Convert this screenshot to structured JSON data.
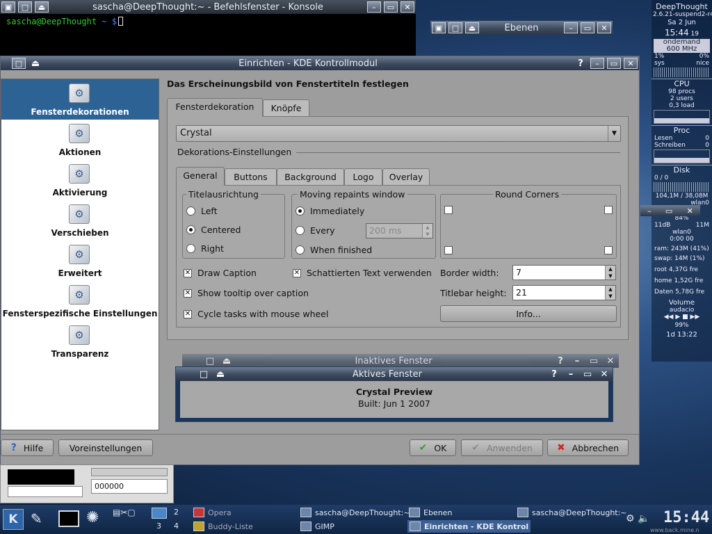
{
  "konsole": {
    "title": "sascha@DeepThought:~ - Befehlsfenster - Konsole",
    "prompt_host": "sascha@DeepThought",
    "prompt_path": "~ $"
  },
  "ebenen": {
    "title": "Ebenen"
  },
  "sysmon": {
    "hostname": "DeepThought",
    "kernel": "2.6.21-suspend2-r4",
    "date": "Sa 2 Jun",
    "time": "15:44",
    "seconds": "19",
    "cpu_governor": "ondemand",
    "cpu_freq": "600 MHz",
    "cpu_pct": "1%",
    "cpu_pct2": "0%",
    "sys": "sys",
    "nice": "nice",
    "cpu_label": "CPU",
    "procs": "98 procs",
    "users": "2 users",
    "load": "0,3 load",
    "proc_label": "Proc",
    "lesen": "Lesen",
    "lesen_v": "0",
    "schreiben": "Schreiben",
    "schreiben_v": "0",
    "disk_label": "Disk",
    "disk_ratio": "0 / 0",
    "disk_mem": "104,1M / 38,08M",
    "wlan_label": "wlan0",
    "wlan_pct": "84%",
    "wlan_db": "11dB",
    "wlan_rate": "11M",
    "wlan2": "wlan0",
    "wlan_time": "0:00  00",
    "ram": "ram: 243M (41%)",
    "swap": "swap: 14M (1%)",
    "root": "root 4,37G fre",
    "home": "home 1,52G fre",
    "daten": "Daten 5,78G fre",
    "volume_label": "Volume",
    "audacio": "audacio",
    "battery": "99%",
    "uptime": "1d 13:22"
  },
  "dialog": {
    "title": "Einrichten - KDE Kontrollmodul",
    "heading": "Das Erscheinungsbild von Fenstertiteln festlegen",
    "sidebar": [
      "Fensterdekorationen",
      "Aktionen",
      "Aktivierung",
      "Verschieben",
      "Erweitert",
      "Fensterspezifische Einstellungen",
      "Transparenz"
    ],
    "main_tabs": [
      "Fensterdekoration",
      "Knöpfe"
    ],
    "decoration": "Crystal",
    "deco_settings": "Dekorations-Einstellungen",
    "sub_tabs": [
      "General",
      "Buttons",
      "Background",
      "Logo",
      "Overlay"
    ],
    "titel_group": "Titelausrichtung",
    "titel_opts": [
      "Left",
      "Centered",
      "Right"
    ],
    "repaint_group": "Moving repaints window",
    "repaint_opts": [
      "Immediately",
      "Every",
      "When finished"
    ],
    "repaint_ms": "200 ms",
    "corners_group": "Round Corners",
    "checks": [
      "Draw Caption",
      "Schattierten Text verwenden",
      "Show tooltip over caption",
      "Cycle tasks with mouse wheel"
    ],
    "border_width_label": "Border width:",
    "border_width": "7",
    "titlebar_height_label": "Titlebar height:",
    "titlebar_height": "21",
    "info_button": "Info...",
    "inactive_title": "Inaktives Fenster",
    "active_title": "Aktives Fenster",
    "preview_title": "Crystal Preview",
    "preview_built": "Built: Jun 1 2007",
    "hilfe": "Hilfe",
    "voreinstellungen": "Voreinstellungen",
    "ok": "OK",
    "anwenden": "Anwenden",
    "abbrechen": "Abbrechen"
  },
  "widget": {
    "value": "000000"
  },
  "taskbar": {
    "d1": "2",
    "d2": "3",
    "d3": "4",
    "opera": "Opera",
    "buddy": "Buddy-Liste",
    "t1": "sascha@DeepThought:~",
    "t2": "GIMP",
    "t3": "Ebenen",
    "t4": "Einrichten - KDE Kontrol",
    "t5": "sascha@DeepThought:~",
    "clock": "15:44",
    "url": "www.back.mine.n"
  }
}
